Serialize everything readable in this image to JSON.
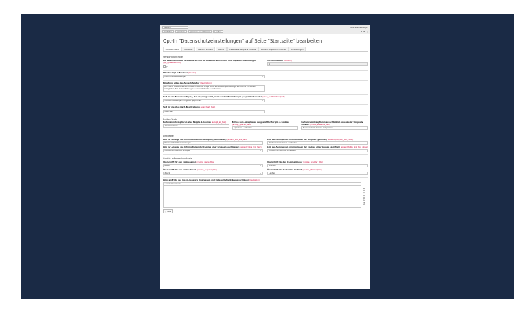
{
  "topbar": {
    "language": "Deutsch",
    "actions": [
      "Schließen",
      "Speichern",
      "Speichern und schließen",
      "Löschen"
    ],
    "user": "Max   Startseite (1)"
  },
  "page": {
    "title": "Opt-In \"Datenschutzeinstellungen\" auf Seite \"Startseite\" bearbeiten",
    "tabs": [
      "Standard-Menü",
      "Textfelder",
      "Element Infotext",
      "Banner",
      "Essenzielle Skripte & Cookies",
      "Weitere Skripte und Cookies",
      "Einstellungen"
    ]
  },
  "form": {
    "versions": {
      "title": "Versionskontrolle",
      "label": "Die Versionsnummer aktualisieren und die Besucher auffordern, ihre Angaben zu bestätigen",
      "key": "(opt_updateVersion)",
      "check_label": "Ja",
      "version_label": "Version number",
      "version_key": "(version)",
      "version_value": "1"
    },
    "title_field": {
      "label": "Titel des Opt-In Fensters",
      "key": "(header)",
      "value": "Datenschutzeinstellungen"
    },
    "intro": {
      "label": "Einleitung unter der Auswahlfenster",
      "key": "(description)",
      "value": "Auf unserer Webseite werden Cookies verwendet. Einige davon werden zwingend benötigt, während es uns andere ermöglichen, Ihre Nutzererfahrung auf unserer Webseite zu verbessern."
    },
    "confirm_text": {
      "label": "Text für die Benachrichtigung, der angezeigt wird, wenn Cookie-Einstellungen gespeichert werden",
      "key": "(save_confirmation_text)",
      "value": "Cookie-Einstellungen erfolgreich gespeichert"
    },
    "user_desc": {
      "label": "Text für die User-Nach-Beschreibung",
      "key": "(user_hash_text)",
      "value": "User-Hash"
    },
    "buttons": {
      "title": "Button-Texte",
      "cols": [
        {
          "label": "Button zum Akzeptieren aller Skripte & Cookies",
          "key": "(accept_all_text)",
          "value": "Alle akzeptieren"
        },
        {
          "label": "Button zum Akzeptieren ausgewählter Skripte & Cookies",
          "key": "(accept_specific_text)",
          "value": "Speichern & schließen"
        },
        {
          "label": "Button zum Akzeptieren ausschließlich essenzieller Skripte & Cookies",
          "key": "(accept_essential_text)",
          "value": "Nur essenzielle Cookies akzeptieren"
        }
      ]
    },
    "links": {
      "title": "Linktexte",
      "rows": [
        [
          {
            "label": "Link zur Anzeige von Informationen der Gruppen (geschlossen)",
            "key": "(extend_box_link_text)",
            "value": "Weitere Informationen anzeigen"
          },
          {
            "label": "Link zur Anzeige von Informationen der Gruppen (geöffnet)",
            "key": "(extend_box_link_text_close)",
            "value": "Weitere Informationen verstecken"
          }
        ],
        [
          {
            "label": "Link zur Anzeige von Informationen der Cookies einer Gruppe (geschlossen)",
            "key": "(extend_table_link_text)",
            "value": "Cookie-Informationen anzeigen"
          },
          {
            "label": "Link zur Anzeige von Informationen der Cookies einer Gruppe (geöffnet)",
            "key": "(extend_table_link_text_close)",
            "value": "Cookie-Informationen verstecken"
          }
        ]
      ]
    },
    "cookie_info": {
      "title": "Cookie-Informationstexte",
      "rows": [
        [
          {
            "label": "Überschrift für den Cookienamen",
            "key": "(cookie_name_title)",
            "value": "Name"
          },
          {
            "label": "Überschrift für den Cookieanbieter",
            "key": "(cookie_provider_title)",
            "value": "Anbieter"
          }
        ],
        [
          {
            "label": "Überschrift für den Cookie-Zweck",
            "key": "(cookie_purpose_title)",
            "value": "Zweck"
          },
          {
            "label": "Überschrift für die Cookie-Laufzeit",
            "key": "(cookie_lifetime_title)",
            "value": "Laufzeit"
          }
        ]
      ]
    },
    "footer_links": {
      "label": "Links am Ende des Opt-In-Fensters (Impressum und Datenschutzerklärung verlinken)",
      "key": "(navigation)",
      "placeholder": "Datensatz suchen",
      "add_button": "Seite"
    }
  }
}
